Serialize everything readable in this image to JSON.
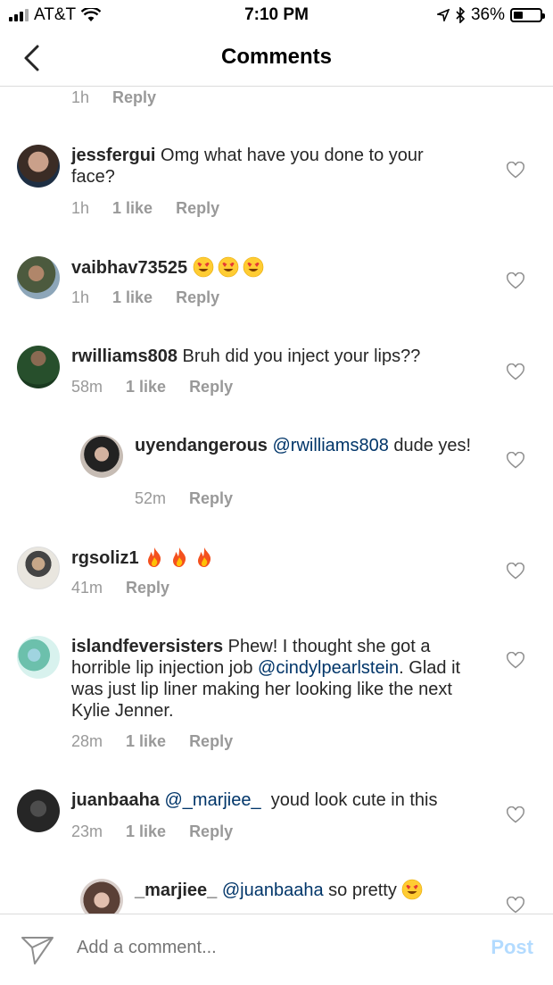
{
  "status_bar": {
    "carrier": "AT&T",
    "time": "7:10 PM",
    "battery": "36%",
    "battery_level": 0.36
  },
  "header": {
    "title": "Comments"
  },
  "top_partial": {
    "time": "1h",
    "reply": "Reply"
  },
  "comments": [
    {
      "user": "jessfergui",
      "text": " Omg what have you done to your face?",
      "time": "1h",
      "likes": "1 like",
      "reply": "Reply"
    },
    {
      "user": "vaibhav73525",
      "text": "",
      "emoji": [
        "heart-eyes-emoji",
        "heart-eyes-emoji",
        "heart-eyes-emoji"
      ],
      "time": "1h",
      "likes": "1 like",
      "reply": "Reply"
    },
    {
      "user": "rwilliams808",
      "text": " Bruh did you inject your lips??",
      "time": "58m",
      "likes": "1 like",
      "reply": "Reply"
    },
    {
      "user": "uyendangerous",
      "mention": "@rwilliams808",
      "text": " dude yes!",
      "time": "52m",
      "reply": "Reply"
    },
    {
      "user": "rgsoliz1",
      "text": "",
      "emoji": [
        "fire-emoji",
        "fire-emoji",
        "fire-emoji"
      ],
      "time": "41m",
      "reply": "Reply"
    },
    {
      "user": "islandfeversisters",
      "text": " Phew! I thought she got a horrible lip injection job ",
      "mention": "@cindylpearlstein",
      "text2": ". Glad it was just lip liner making her looking like the next Kylie Jenner.",
      "time": "28m",
      "likes": "1 like",
      "reply": "Reply"
    },
    {
      "user": "juanbaaha",
      "mention": "@_marjiee_",
      "text": "  youd look cute in this",
      "time": "23m",
      "likes": "1 like",
      "reply": "Reply"
    },
    {
      "user": "_marjiee_",
      "mention": "@juanbaaha",
      "text": " so pretty ",
      "emoji": [
        "heart-eyes-emoji"
      ]
    }
  ],
  "composer": {
    "placeholder": "Add a comment...",
    "post_label": "Post"
  },
  "colors": {
    "mention": "#003569",
    "meta": "#999999",
    "post_disabled": "#b3dbff",
    "divider": "#dbdbdb"
  }
}
